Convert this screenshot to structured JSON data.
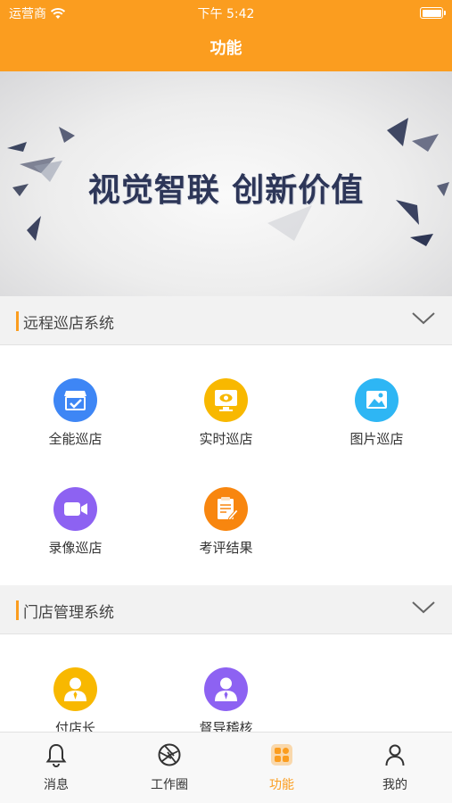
{
  "status_bar": {
    "carrier": "运营商",
    "time": "下午 5:42"
  },
  "header": {
    "title": "功能"
  },
  "banner": {
    "text": "视觉智联  创新价值"
  },
  "colors": {
    "accent": "#fb9d1f",
    "banner_text": "#2d3658"
  },
  "sections": [
    {
      "title": "远程巡店系统",
      "items": [
        {
          "label": "全能巡店",
          "icon": "store-check-icon",
          "color": "#3e86f5"
        },
        {
          "label": "实时巡店",
          "icon": "live-monitor-icon",
          "color": "#f8b800"
        },
        {
          "label": "图片巡店",
          "icon": "picture-icon",
          "color": "#2eb6f4"
        },
        {
          "label": "录像巡店",
          "icon": "video-camera-icon",
          "color": "#8d62f2"
        },
        {
          "label": "考评结果",
          "icon": "evaluation-doc-icon",
          "color": "#f8860f"
        }
      ]
    },
    {
      "title": "门店管理系统",
      "items": [
        {
          "label": "付店长",
          "icon": "manager-person-icon",
          "color": "#f8b800"
        },
        {
          "label": "督导稽核",
          "icon": "supervisor-person-icon",
          "color": "#8d62f2"
        }
      ]
    }
  ],
  "tabbar": [
    {
      "label": "消息",
      "icon": "bell-icon",
      "active": false
    },
    {
      "label": "工作圈",
      "icon": "aperture-icon",
      "active": false
    },
    {
      "label": "功能",
      "icon": "apps-grid-icon",
      "active": true
    },
    {
      "label": "我的",
      "icon": "user-icon",
      "active": false
    }
  ]
}
